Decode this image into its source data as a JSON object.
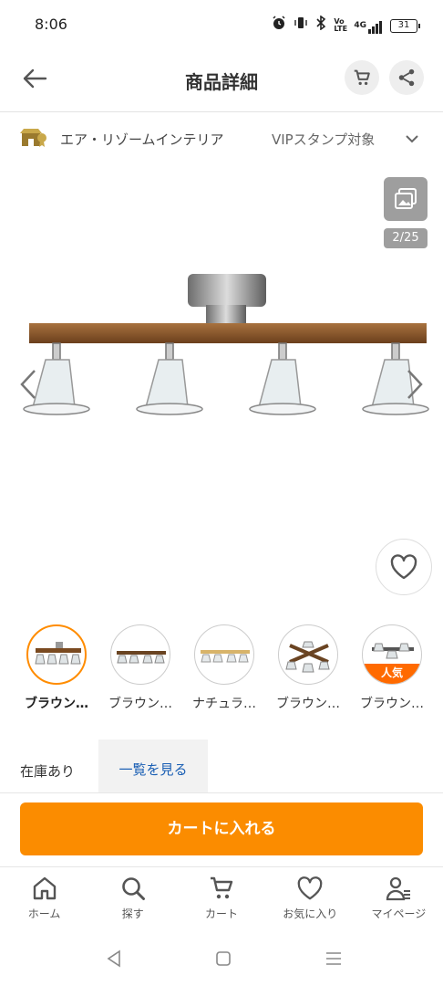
{
  "status_bar": {
    "time": "8:06",
    "icons": [
      "alarm-icon",
      "vibrate-icon",
      "bluetooth-icon",
      "volte-icon",
      "signal-4g-icon",
      "battery-icon"
    ],
    "volte": "Vo LTE",
    "network": "4G",
    "battery": "31"
  },
  "header": {
    "title": "商品詳細",
    "back_icon": "arrow-left-icon",
    "cart_icon": "cart-icon",
    "share_icon": "share-icon"
  },
  "shop": {
    "name": "エア・リゾームインテリア",
    "vip": "VIPスタンプ対象",
    "expand_icon": "chevron-down-icon"
  },
  "gallery": {
    "counter": "2/25",
    "gallery_icon": "gallery-icon"
  },
  "variations": [
    {
      "label": "ブラウン…",
      "selected": true,
      "popular": false
    },
    {
      "label": "ブラウン…",
      "selected": false,
      "popular": false
    },
    {
      "label": "ナチュラ…",
      "selected": false,
      "popular": false
    },
    {
      "label": "ブラウン…",
      "selected": false,
      "popular": false
    },
    {
      "label": "ブラウン…",
      "selected": false,
      "popular": true,
      "badge": "人気"
    }
  ],
  "stock": {
    "status": "在庫あり",
    "view_list": "一覧を見る"
  },
  "cart_button": "カートに入れる",
  "bottom_nav": [
    {
      "label": "ホーム",
      "icon": "home-icon"
    },
    {
      "label": "探す",
      "icon": "search-icon"
    },
    {
      "label": "カート",
      "icon": "cart-icon"
    },
    {
      "label": "お気に入り",
      "icon": "heart-icon"
    },
    {
      "label": "マイページ",
      "icon": "user-icon"
    }
  ],
  "colors": {
    "accent": "#fb8c00",
    "popular_badge": "#ff6a00",
    "link": "#1a5fb4"
  }
}
